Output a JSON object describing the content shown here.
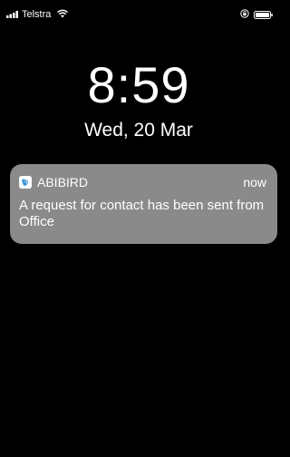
{
  "status_bar": {
    "carrier": "Telstra",
    "icons": {
      "signal": "signal-bars-icon",
      "wifi": "wifi-icon",
      "orientation_lock": "orientation-lock-icon",
      "battery": "battery-icon"
    }
  },
  "lock_screen": {
    "time": "8:59",
    "date": "Wed, 20 Mar"
  },
  "notification": {
    "app_name": "ABIBIRD",
    "timestamp": "now",
    "message": "A request for contact has been sent from Office",
    "icon": "abibird-app-icon"
  },
  "colors": {
    "background": "#000000",
    "notification_bg": "#8a8a8a",
    "text": "#ffffff",
    "app_icon_accent": "#3a9ad9"
  }
}
